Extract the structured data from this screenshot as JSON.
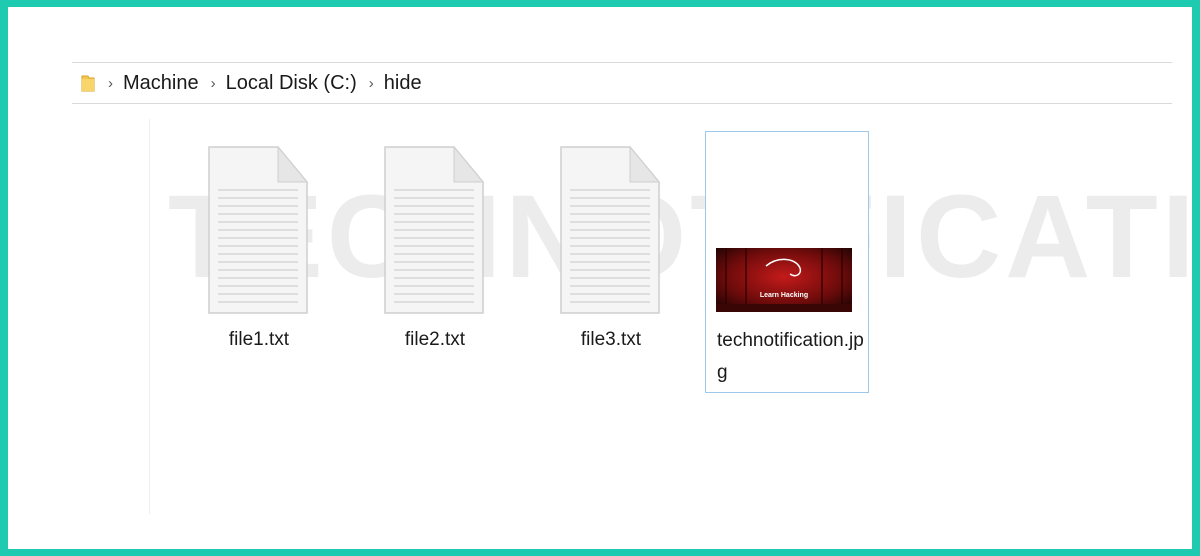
{
  "breadcrumb": {
    "items": [
      "Machine",
      "Local Disk (C:)",
      "hide"
    ],
    "separator": ">"
  },
  "files": [
    {
      "name": "file1.txt",
      "icon": "text-document-icon"
    },
    {
      "name": "file2.txt",
      "icon": "text-document-icon"
    },
    {
      "name": "file3.txt",
      "icon": "text-document-icon"
    },
    {
      "name": "technotification.jpg",
      "icon": "image-thumbnail",
      "selected": true,
      "thumb_caption": "Learn Hacking"
    }
  ],
  "watermark": "TECHNOTIFICATION",
  "colors": {
    "frame_border": "#1ecbb0",
    "selection_border": "#9fc7ea",
    "folder_yellow": "#f3c74d",
    "thumb_red": "#8b0f0f"
  }
}
